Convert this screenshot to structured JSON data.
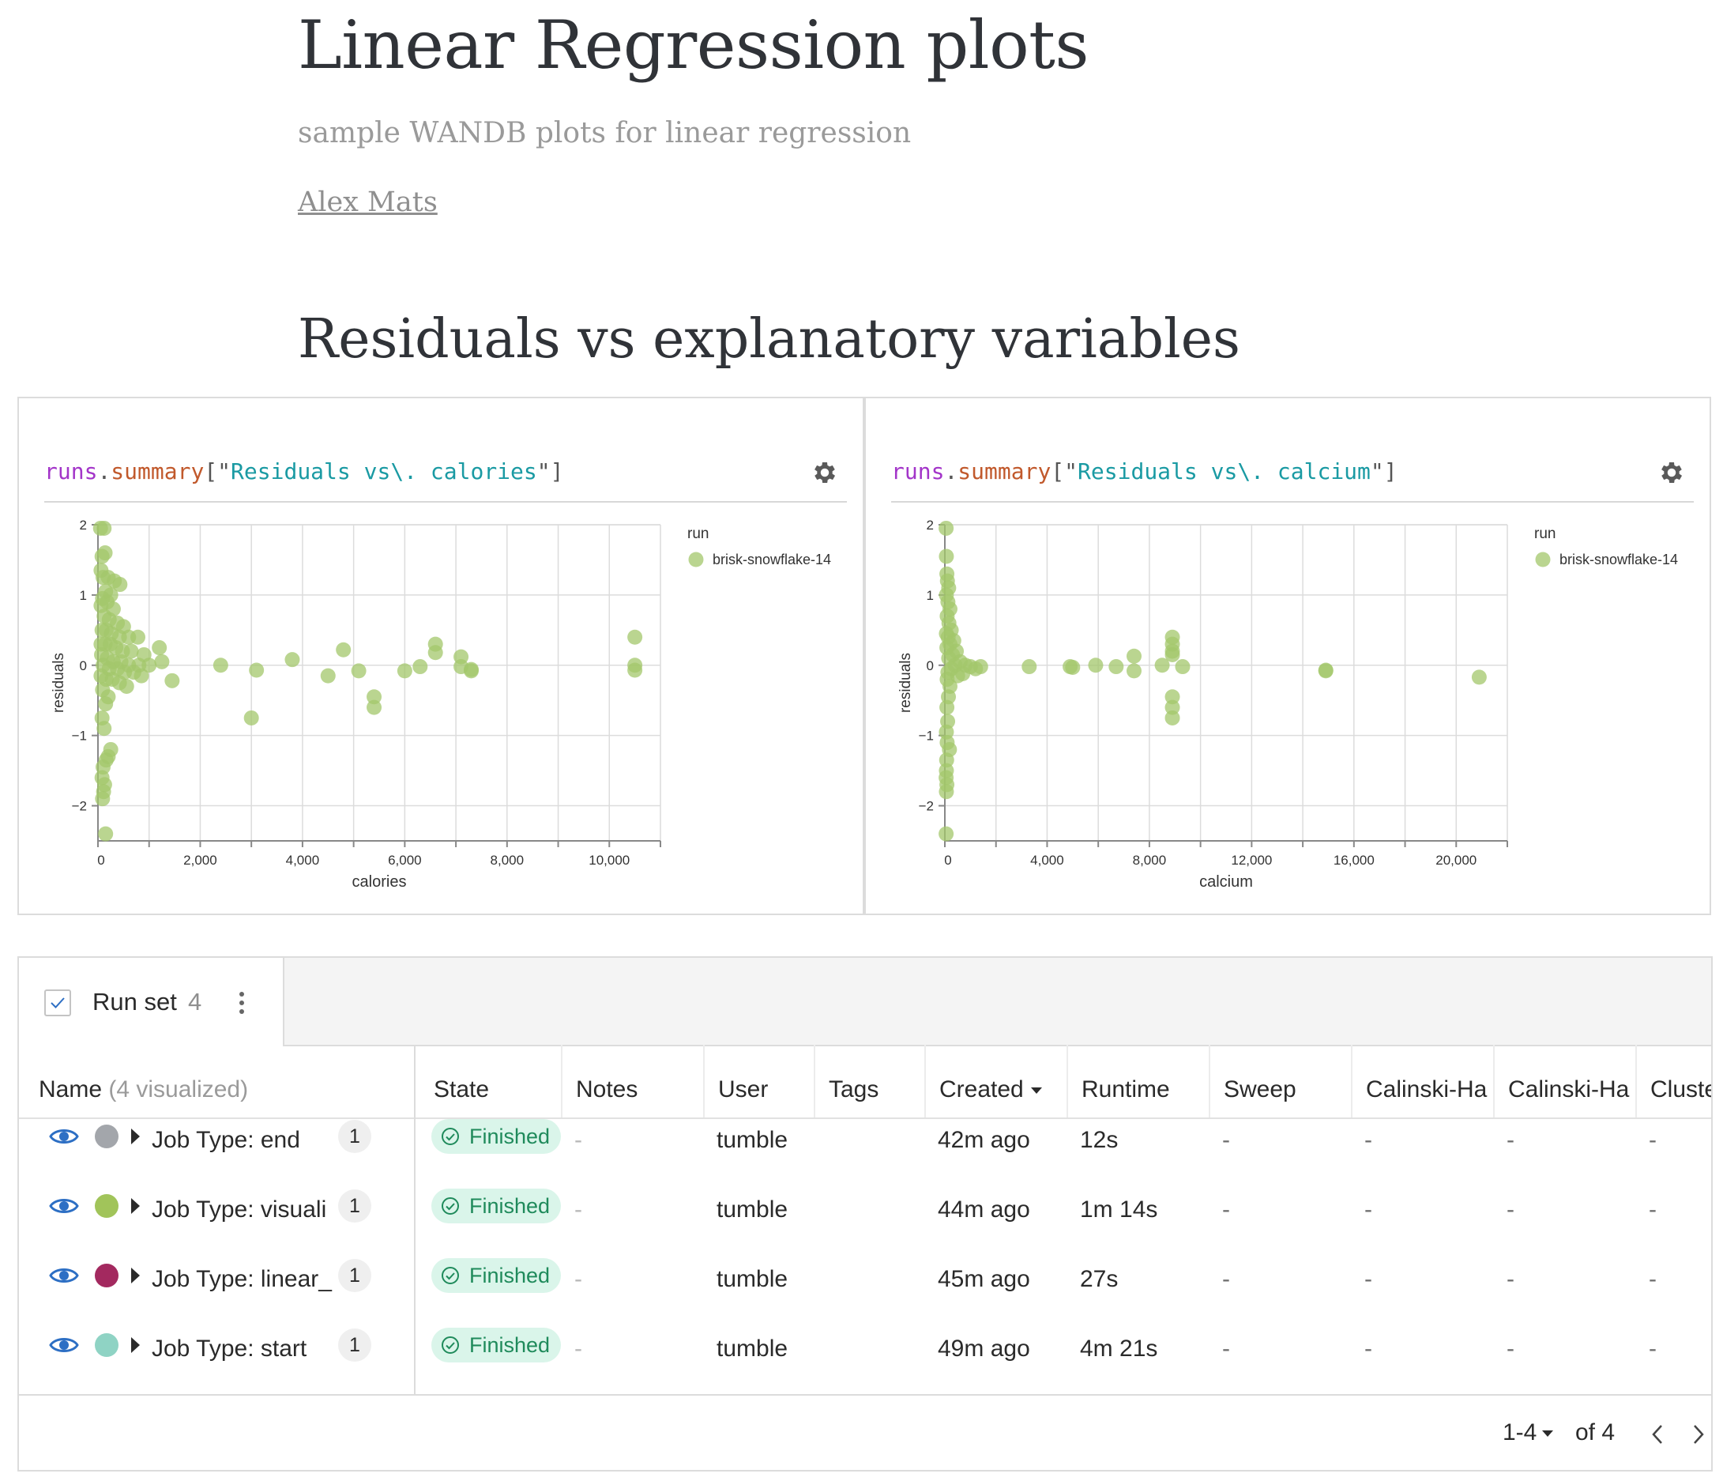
{
  "page": {
    "title": "Linear Regression plots",
    "subtitle": "sample WANDB plots for linear regression",
    "author": "Alex Mats",
    "section_title": "Residuals vs explanatory variables"
  },
  "panels": [
    {
      "expr": {
        "p1": "runs",
        "p2": ".",
        "p3": "summary",
        "p4": "[\"",
        "p5": "Residuals vs\\. calories",
        "p6": "\"]"
      }
    },
    {
      "expr": {
        "p1": "runs",
        "p2": ".",
        "p3": "summary",
        "p4": "[\"",
        "p5": "Residuals vs\\. calcium",
        "p6": "\"]"
      }
    }
  ],
  "chart_data": [
    {
      "type": "scatter",
      "xlabel": "calories",
      "ylabel": "residuals",
      "xlim": [
        0,
        11000
      ],
      "ylim": [
        -2.5,
        2
      ],
      "xticks": [
        0,
        2000,
        4000,
        6000,
        8000,
        10000
      ],
      "xtick_labels": [
        "0",
        "2,000",
        "4,000",
        "6,000",
        "8,000",
        "10,000"
      ],
      "yticks": [
        -2,
        -1,
        0,
        1,
        2
      ],
      "ytick_labels": [
        "−2",
        "−1",
        "0",
        "1",
        "2"
      ],
      "grid": true,
      "legend": {
        "title": "run",
        "placement": "right",
        "entries": [
          "brisk-snowflake-14"
        ]
      },
      "series": [
        {
          "name": "brisk-snowflake-14",
          "color": "#a3c76b",
          "points": [
            [
              50,
              1.95
            ],
            [
              120,
              1.95
            ],
            [
              80,
              1.55
            ],
            [
              140,
              1.6
            ],
            [
              60,
              1.35
            ],
            [
              100,
              1.25
            ],
            [
              200,
              1.25
            ],
            [
              320,
              1.2
            ],
            [
              430,
              1.15
            ],
            [
              150,
              1.05
            ],
            [
              250,
              1.0
            ],
            [
              90,
              0.95
            ],
            [
              180,
              0.9
            ],
            [
              60,
              0.85
            ],
            [
              300,
              0.8
            ],
            [
              120,
              0.7
            ],
            [
              220,
              0.65
            ],
            [
              380,
              0.6
            ],
            [
              500,
              0.55
            ],
            [
              80,
              0.5
            ],
            [
              160,
              0.5
            ],
            [
              260,
              0.45
            ],
            [
              420,
              0.4
            ],
            [
              600,
              0.4
            ],
            [
              780,
              0.4
            ],
            [
              60,
              0.3
            ],
            [
              140,
              0.3
            ],
            [
              240,
              0.3
            ],
            [
              350,
              0.25
            ],
            [
              480,
              0.2
            ],
            [
              650,
              0.2
            ],
            [
              900,
              0.15
            ],
            [
              70,
              0.15
            ],
            [
              180,
              0.1
            ],
            [
              300,
              0.05
            ],
            [
              450,
              0.05
            ],
            [
              600,
              0.0
            ],
            [
              800,
              0.0
            ],
            [
              1000,
              0.0
            ],
            [
              100,
              0.0
            ],
            [
              220,
              -0.05
            ],
            [
              380,
              -0.05
            ],
            [
              520,
              -0.1
            ],
            [
              700,
              -0.1
            ],
            [
              850,
              -0.15
            ],
            [
              60,
              -0.15
            ],
            [
              160,
              -0.2
            ],
            [
              280,
              -0.2
            ],
            [
              420,
              -0.25
            ],
            [
              560,
              -0.3
            ],
            [
              90,
              -0.35
            ],
            [
              200,
              -0.45
            ],
            [
              150,
              -0.55
            ],
            [
              80,
              -0.75
            ],
            [
              120,
              -0.9
            ],
            [
              250,
              -1.2
            ],
            [
              200,
              -1.3
            ],
            [
              160,
              -1.35
            ],
            [
              100,
              -1.45
            ],
            [
              80,
              -1.6
            ],
            [
              130,
              -1.7
            ],
            [
              110,
              -1.8
            ],
            [
              90,
              -1.9
            ],
            [
              150,
              -2.4
            ],
            [
              1200,
              0.25
            ],
            [
              1250,
              0.05
            ],
            [
              1450,
              -0.22
            ],
            [
              2400,
              0.0
            ],
            [
              3000,
              -0.75
            ],
            [
              3100,
              -0.07
            ],
            [
              3800,
              0.08
            ],
            [
              4500,
              -0.15
            ],
            [
              4800,
              0.22
            ],
            [
              5100,
              -0.08
            ],
            [
              5400,
              -0.45
            ],
            [
              5400,
              -0.6
            ],
            [
              6000,
              -0.08
            ],
            [
              6300,
              -0.02
            ],
            [
              6600,
              0.3
            ],
            [
              6600,
              0.18
            ],
            [
              7100,
              0.12
            ],
            [
              7100,
              -0.02
            ],
            [
              7300,
              -0.08
            ],
            [
              7300,
              -0.06
            ],
            [
              10500,
              0.4
            ],
            [
              10500,
              0.0
            ],
            [
              10500,
              -0.07
            ]
          ]
        }
      ]
    },
    {
      "type": "scatter",
      "xlabel": "calcium",
      "ylabel": "residuals",
      "xlim": [
        0,
        22000
      ],
      "ylim": [
        -2.5,
        2
      ],
      "xticks": [
        0,
        4000,
        8000,
        12000,
        16000,
        20000
      ],
      "xtick_labels": [
        "0",
        "4,000",
        "8,000",
        "12,000",
        "16,000",
        "20,000"
      ],
      "yticks": [
        -2,
        -1,
        0,
        1,
        2
      ],
      "ytick_labels": [
        "−2",
        "−1",
        "0",
        "1",
        "2"
      ],
      "grid": true,
      "legend": {
        "title": "run",
        "placement": "right",
        "entries": [
          "brisk-snowflake-14"
        ]
      },
      "series": [
        {
          "name": "brisk-snowflake-14",
          "color": "#a3c76b",
          "points": [
            [
              50,
              1.95
            ],
            [
              60,
              1.55
            ],
            [
              80,
              1.3
            ],
            [
              100,
              1.2
            ],
            [
              150,
              1.1
            ],
            [
              60,
              1.0
            ],
            [
              120,
              0.9
            ],
            [
              200,
              0.8
            ],
            [
              90,
              0.7
            ],
            [
              160,
              0.6
            ],
            [
              250,
              0.5
            ],
            [
              60,
              0.45
            ],
            [
              130,
              0.4
            ],
            [
              350,
              0.35
            ],
            [
              200,
              0.3
            ],
            [
              80,
              0.25
            ],
            [
              450,
              0.2
            ],
            [
              300,
              0.15
            ],
            [
              150,
              0.1
            ],
            [
              600,
              0.05
            ],
            [
              400,
              0.0
            ],
            [
              800,
              0.0
            ],
            [
              1000,
              -0.02
            ],
            [
              1200,
              -0.05
            ],
            [
              1400,
              -0.02
            ],
            [
              250,
              -0.05
            ],
            [
              120,
              -0.1
            ],
            [
              500,
              -0.15
            ],
            [
              700,
              -0.12
            ],
            [
              90,
              -0.2
            ],
            [
              200,
              -0.3
            ],
            [
              140,
              -0.45
            ],
            [
              80,
              -0.6
            ],
            [
              110,
              -0.8
            ],
            [
              60,
              -0.95
            ],
            [
              90,
              -1.1
            ],
            [
              180,
              -1.2
            ],
            [
              70,
              -1.35
            ],
            [
              60,
              -1.5
            ],
            [
              50,
              -1.6
            ],
            [
              80,
              -1.7
            ],
            [
              60,
              -1.8
            ],
            [
              50,
              -2.4
            ],
            [
              3300,
              -0.02
            ],
            [
              4900,
              -0.02
            ],
            [
              5000,
              -0.03
            ],
            [
              5900,
              0.0
            ],
            [
              6700,
              -0.02
            ],
            [
              7400,
              0.13
            ],
            [
              7400,
              -0.08
            ],
            [
              8500,
              0.0
            ],
            [
              8900,
              0.4
            ],
            [
              8900,
              0.3
            ],
            [
              8900,
              0.2
            ],
            [
              8900,
              0.15
            ],
            [
              8900,
              -0.45
            ],
            [
              8900,
              -0.6
            ],
            [
              8900,
              -0.75
            ],
            [
              9300,
              -0.02
            ],
            [
              14900,
              -0.07
            ],
            [
              14900,
              -0.08
            ],
            [
              20900,
              -0.17
            ]
          ]
        }
      ]
    }
  ],
  "runset": {
    "tab_label": "Run set",
    "tab_count": "4",
    "columns": {
      "name": "Name",
      "name_suffix": "(4 visualized)",
      "state": "State",
      "notes": "Notes",
      "user": "User",
      "tags": "Tags",
      "created": "Created",
      "runtime": "Runtime",
      "sweep": "Sweep",
      "ch1": "Calinski-Ha",
      "ch2": "Calinski-Ha",
      "cluster": "Cluste"
    },
    "rows": [
      {
        "name": "Job Type: end",
        "count": "1",
        "color": "#a3a6ab",
        "state": "Finished",
        "notes": "-",
        "user": "tumble",
        "created": "42m ago",
        "runtime": "12s",
        "sweep": "-",
        "ch1": "-",
        "ch2": "-",
        "cluster": "-"
      },
      {
        "name": "Job Type: visuali",
        "count": "1",
        "color": "#a1c45a",
        "state": "Finished",
        "notes": "-",
        "user": "tumble",
        "created": "44m ago",
        "runtime": "1m 14s",
        "sweep": "-",
        "ch1": "-",
        "ch2": "-",
        "cluster": "-"
      },
      {
        "name": "Job Type: linear_",
        "count": "1",
        "color": "#a3295f",
        "state": "Finished",
        "notes": "-",
        "user": "tumble",
        "created": "45m ago",
        "runtime": "27s",
        "sweep": "-",
        "ch1": "-",
        "ch2": "-",
        "cluster": "-"
      },
      {
        "name": "Job Type: start",
        "count": "1",
        "color": "#8fd3c4",
        "state": "Finished",
        "notes": "-",
        "user": "tumble",
        "created": "49m ago",
        "runtime": "4m 21s",
        "sweep": "-",
        "ch1": "-",
        "ch2": "-",
        "cluster": "-"
      }
    ],
    "pagination": {
      "range": "1-4",
      "total": "of 4"
    }
  },
  "icons": {
    "gear": "gear-icon",
    "eye": "eye-icon",
    "check": "check-circle-icon",
    "kebab": "kebab-menu-icon",
    "sort": "sort-desc-icon",
    "prev": "chevron-left-icon",
    "next": "chevron-right-icon",
    "expand": "caret-right-icon"
  },
  "colors": {
    "eye": "#2d6fc4",
    "finished_bg": "#daf5ea",
    "finished_fg": "#1f8a5b",
    "point": "#a3c76b"
  }
}
